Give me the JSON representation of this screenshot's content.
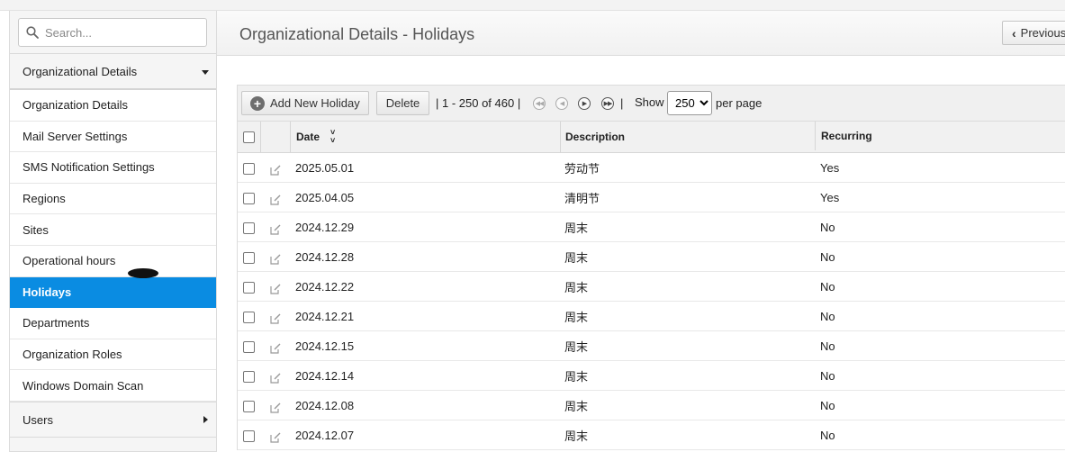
{
  "sidebar": {
    "search_placeholder": "Search...",
    "section_title": "Organizational Details",
    "items": [
      {
        "label": "Organization Details"
      },
      {
        "label": "Mail Server Settings"
      },
      {
        "label": "SMS Notification Settings"
      },
      {
        "label": "Regions"
      },
      {
        "label": "Sites"
      },
      {
        "label": "Operational hours"
      },
      {
        "label": "Holidays",
        "active": true
      },
      {
        "label": "Departments"
      },
      {
        "label": "Organization Roles"
      },
      {
        "label": "Windows Domain Scan"
      }
    ],
    "users_label": "Users"
  },
  "header": {
    "title": "Organizational Details - Holidays",
    "previous_label": "Previous"
  },
  "toolbar": {
    "add_label": "Add New Holiday",
    "delete_label": "Delete",
    "pager_text": "| 1 - 250 of 460 |",
    "sep": "|",
    "show_label": "Show",
    "per_page_value": "250",
    "per_page_label": "per page"
  },
  "table": {
    "columns": {
      "date": "Date",
      "description": "Description",
      "recurring": "Recurring"
    },
    "rows": [
      {
        "date": "2025.05.01",
        "description": "劳动节",
        "recurring": "Yes"
      },
      {
        "date": "2025.04.05",
        "description": "清明节",
        "recurring": "Yes"
      },
      {
        "date": "2024.12.29",
        "description": "周末",
        "recurring": "No"
      },
      {
        "date": "2024.12.28",
        "description": "周末",
        "recurring": "No"
      },
      {
        "date": "2024.12.22",
        "description": "周末",
        "recurring": "No"
      },
      {
        "date": "2024.12.21",
        "description": "周末",
        "recurring": "No"
      },
      {
        "date": "2024.12.15",
        "description": "周末",
        "recurring": "No"
      },
      {
        "date": "2024.12.14",
        "description": "周末",
        "recurring": "No"
      },
      {
        "date": "2024.12.08",
        "description": "周末",
        "recurring": "No"
      },
      {
        "date": "2024.12.07",
        "description": "周末",
        "recurring": "No"
      }
    ]
  },
  "colors": {
    "accent": "#0a8ce2"
  }
}
